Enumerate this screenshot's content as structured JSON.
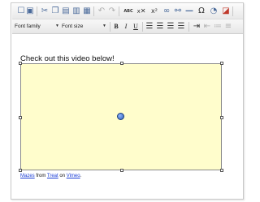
{
  "toolbar_top": {
    "icons": [
      "new-document-icon",
      "save-icon",
      "cut-icon",
      "copy-icon",
      "paste-icon",
      "paste-text-icon",
      "paste-word-icon",
      "undo-icon",
      "redo-icon",
      "spellcheck-icon",
      "remove-format-icon",
      "superscript-icon",
      "link-icon",
      "unlink-icon",
      "horizontal-rule-icon",
      "special-char-icon",
      "image-icon",
      "source-icon"
    ],
    "spellcheck_label": "ABC",
    "remove_format_label": "✕",
    "superscript_label": "x²",
    "omega_label": "Ω"
  },
  "toolbar_bottom": {
    "font_family": "Font family",
    "font_size": "Font size",
    "bold": "B",
    "italic": "I",
    "underline": "U"
  },
  "content": {
    "heading": "Check out this video below!",
    "caption": {
      "link1": "Mazes",
      "text1": " from ",
      "link2": "Treat",
      "text2": " on ",
      "link3": "Vimeo",
      "text3": "."
    }
  }
}
